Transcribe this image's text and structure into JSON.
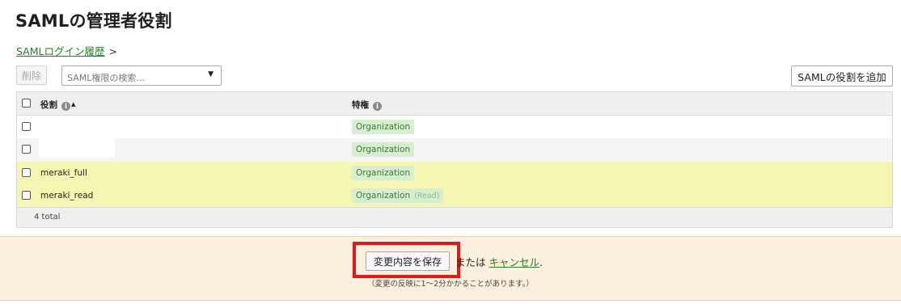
{
  "page_title": "SAMLの管理者役割",
  "breadcrumb": {
    "link": "SAMLログイン履歴",
    "separator": ">"
  },
  "toolbar": {
    "delete_label": "削除",
    "search_placeholder": "SAML権限の検索...",
    "add_label": "SAMLの役割を追加"
  },
  "table": {
    "headers": {
      "role": "役割",
      "privilege": "特権"
    },
    "rows": [
      {
        "role": "",
        "privilege": "Organization",
        "privilege_sub": "",
        "highlighted": false
      },
      {
        "role": "",
        "privilege": "Organization",
        "privilege_sub": "",
        "highlighted": false
      },
      {
        "role": "meraki_full",
        "privilege": "Organization",
        "privilege_sub": "",
        "highlighted": true
      },
      {
        "role": "meraki_read",
        "privilege": "Organization",
        "privilege_sub": "(Read)",
        "highlighted": true
      }
    ],
    "total": "4 total"
  },
  "savebar": {
    "save_label": "変更内容を保存",
    "or_text": "または",
    "cancel_label": "キャンセル",
    "period": ".",
    "note": "（変更の反映に1〜2分かかることがあります。）"
  },
  "icons": {
    "info": "info-icon",
    "sort": "sort-ascending-icon",
    "dropdown": "chevron-down-icon"
  },
  "colors": {
    "highlight_row": "#f5f6b4",
    "badge_bg": "#d8eed1",
    "badge_text": "#3b7a2e",
    "link": "#2a7a2a",
    "annotation_box": "#e01a1a",
    "savebar_bg": "#fbf0dd"
  }
}
